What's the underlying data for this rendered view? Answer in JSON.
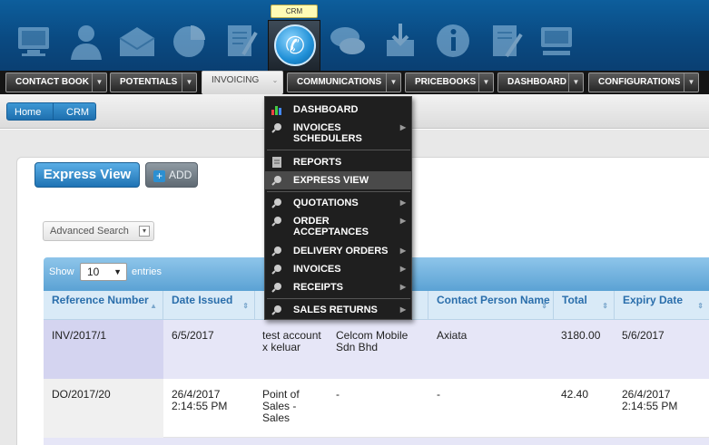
{
  "topbar": {
    "active_tooltip": "CRM",
    "icons": [
      "monitor-icon",
      "user-icon",
      "envelope-icon",
      "pie-chart-icon",
      "document-pen-icon",
      "phone-icon",
      "chat-icon",
      "inbox-icon",
      "info-icon",
      "document-edit-icon",
      "computer-icon"
    ]
  },
  "nav": {
    "items": [
      {
        "label": "CONTACT BOOK"
      },
      {
        "label": "POTENTIALS"
      },
      {
        "label": "INVOICING"
      },
      {
        "label": "COMMUNICATIONS"
      },
      {
        "label": "PRICEBOOKS"
      },
      {
        "label": "DASHBOARD"
      },
      {
        "label": "CONFIGURATIONS"
      }
    ],
    "active": "INVOICING"
  },
  "breadcrumb": {
    "home": "Home",
    "crm": "CRM"
  },
  "toolbar": {
    "express_view": "Express View",
    "add": "ADD"
  },
  "advanced_search": "Advanced Search",
  "table": {
    "show_label": "Show",
    "show_value": "10",
    "entries_label": "entries",
    "columns": [
      "Reference Number",
      "Date Issued",
      "",
      "",
      "Contact Person Name",
      "Total",
      "Expiry Date"
    ],
    "rows": [
      {
        "ref": "INV/2017/1",
        "date": "6/5/2017",
        "desc": "test account x keluar",
        "company": "Celcom Mobile Sdn Bhd",
        "contact": "Axiata",
        "total": "3180.00",
        "expiry": "5/6/2017"
      },
      {
        "ref": "DO/2017/20",
        "date": "26/4/2017 2:14:55 PM",
        "desc": "Point of Sales - Sales",
        "company": "-",
        "contact": "-",
        "total": "42.40",
        "expiry": "26/4/2017 2:14:55 PM"
      }
    ]
  },
  "menu": {
    "items": [
      {
        "label": "DASHBOARD",
        "icon": "bar-chart-icon"
      },
      {
        "label": "INVOICES SCHEDULERS",
        "icon": "search-icon",
        "submenu": true
      },
      {
        "label": "REPORTS",
        "icon": "report-icon"
      },
      {
        "label": "EXPRESS VIEW",
        "icon": "search-icon",
        "highlighted": true
      },
      {
        "label": "QUOTATIONS",
        "icon": "search-icon",
        "submenu": true
      },
      {
        "label": "ORDER ACCEPTANCES",
        "icon": "search-icon",
        "submenu": true
      },
      {
        "label": "DELIVERY ORDERS",
        "icon": "search-icon",
        "submenu": true
      },
      {
        "label": "INVOICES",
        "icon": "search-icon",
        "submenu": true
      },
      {
        "label": "RECEIPTS",
        "icon": "search-icon",
        "submenu": true
      },
      {
        "label": "SALES RETURNS",
        "icon": "search-icon",
        "submenu": true
      }
    ]
  },
  "colors": {
    "accent": "#1f73b4",
    "header_bar": "#0a4a82",
    "menu_bg": "#1f1f1f"
  }
}
